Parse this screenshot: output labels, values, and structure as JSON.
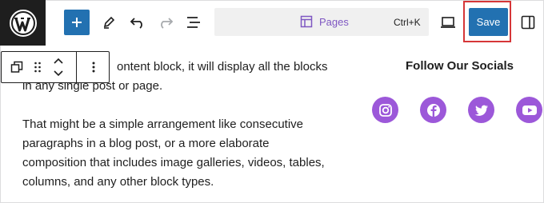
{
  "toolbar": {
    "logo_icon": "wordpress-logo",
    "command_label": "Pages",
    "command_shortcut": "Ctrl+K",
    "save_label": "Save"
  },
  "content": {
    "paragraph_1": "ontent block, it will display all the blocks in any single post or page.",
    "paragraph_2": "That might be a simple arrangement like consecutive paragraphs in a blog post, or a more elaborate composition that includes image galleries, videos, tables, columns, and any other block types."
  },
  "sidebar": {
    "heading": "Follow Our Socials",
    "social_icons": [
      "instagram-icon",
      "facebook-icon",
      "twitter-icon",
      "youtube-icon"
    ]
  },
  "colors": {
    "accent_blue": "#2271b1",
    "highlight_red": "#d63638",
    "social_purple": "#9c58d9",
    "command_purple": "#7e57c2"
  }
}
